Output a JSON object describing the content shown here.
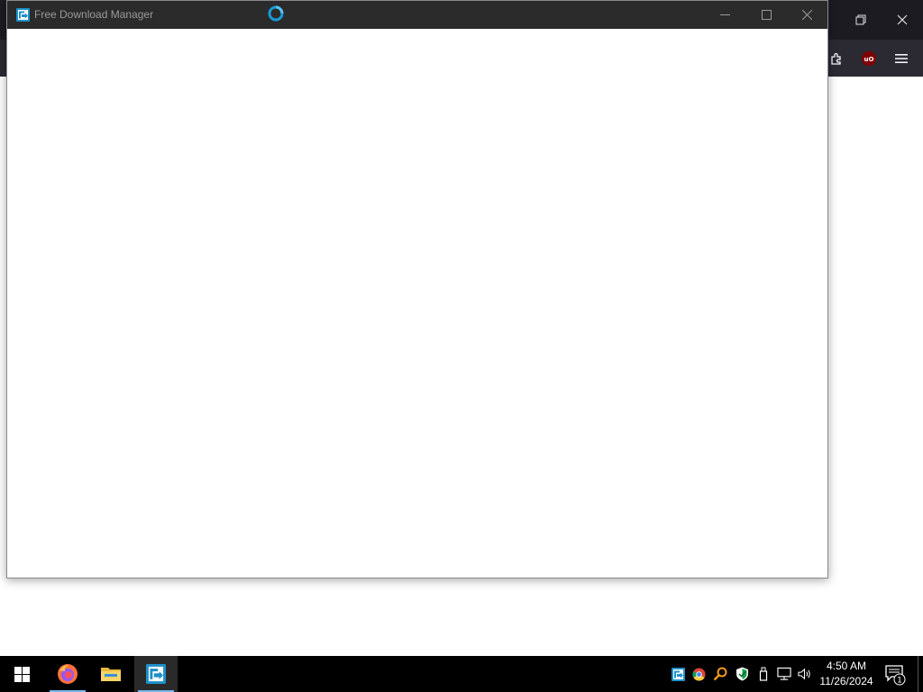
{
  "background_browser": {
    "window_controls": [
      "restore",
      "close"
    ],
    "toolbar_icons": [
      "extensions-icon",
      "ublock-origin-icon",
      "menu-icon"
    ]
  },
  "fdm_window": {
    "title": "Free Download Manager",
    "state": "loading",
    "window_controls": [
      "minimize",
      "maximize",
      "close"
    ]
  },
  "taskbar": {
    "pinned": [
      "start",
      "firefox",
      "file-explorer",
      "free-download-manager"
    ],
    "active": "free-download-manager",
    "tray_icons": [
      "fdm-tray-icon",
      "chrome-tray-icon",
      "search-tray-icon",
      "security-tray-icon",
      "usb-tray-icon",
      "network-tray-icon",
      "volume-tray-icon"
    ],
    "clock": {
      "time": "4:50 AM",
      "date": "11/26/2024"
    },
    "notification_count": "1"
  },
  "colors": {
    "fdm_titlebar": "#2b2b2b",
    "firefox_toolbar": "#2b2a33",
    "taskbar": "#000000",
    "accent": "#1a9ad6"
  }
}
